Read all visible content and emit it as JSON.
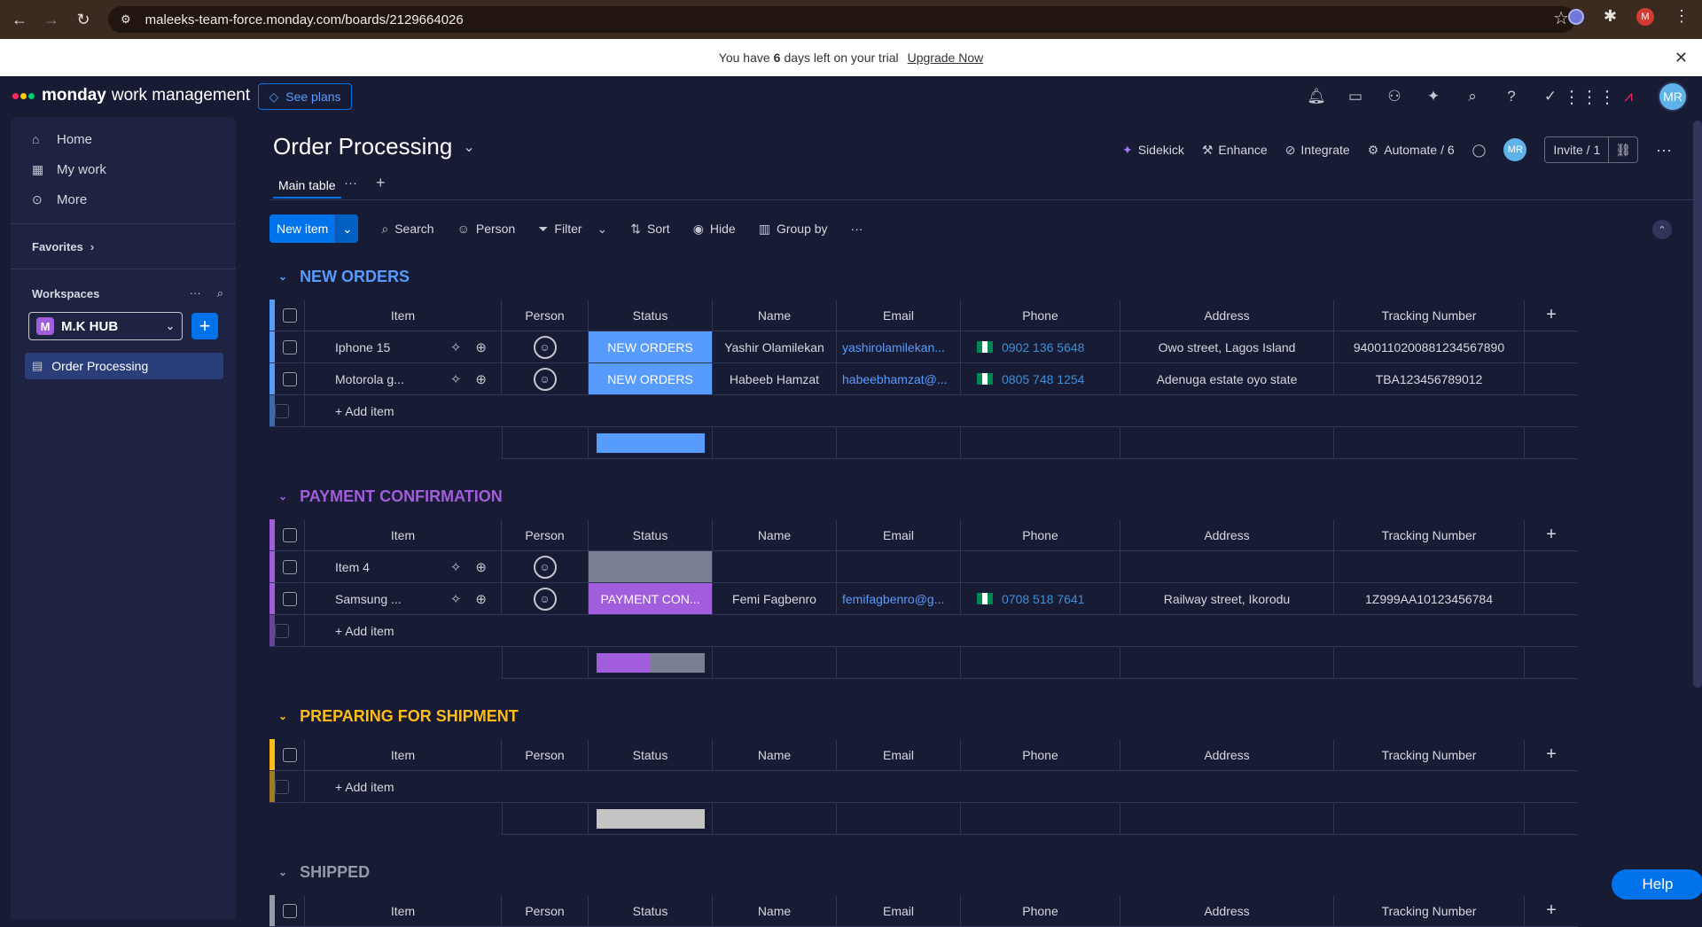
{
  "browser": {
    "url": "maleeks-team-force.monday.com/boards/2129664026",
    "avatar": "M"
  },
  "trial": {
    "text_before": "You have",
    "days": "6",
    "text_after": "days left on your trial",
    "upgrade_label": "Upgrade Now"
  },
  "topbar": {
    "brand": "monday",
    "brand_suffix": "work management",
    "see_plans": "See plans",
    "avatar": "MR"
  },
  "sidebar": {
    "items": [
      {
        "label": "Home",
        "icon": "home-icon"
      },
      {
        "label": "My work",
        "icon": "calendar-icon"
      },
      {
        "label": "More",
        "icon": "more-icon"
      }
    ],
    "favorites": "Favorites",
    "workspaces": "Workspaces",
    "workspace_initial": "M",
    "workspace_name": "M.K HUB",
    "board": "Order Processing"
  },
  "board": {
    "title": "Order Processing",
    "tab": "Main table",
    "actions": {
      "sidekick": "Sidekick",
      "enhance": "Enhance",
      "integrate": "Integrate",
      "automate": "Automate / 6",
      "avatar": "MR",
      "invite": "Invite / 1"
    },
    "toolbar": {
      "new_item": "New item",
      "search": "Search",
      "person": "Person",
      "filter": "Filter",
      "sort": "Sort",
      "hide": "Hide",
      "group_by": "Group by"
    }
  },
  "columns": [
    "Item",
    "Person",
    "Status",
    "Name",
    "Email",
    "Phone",
    "Address",
    "Tracking Number"
  ],
  "add_item": "+ Add item",
  "groups": [
    {
      "title": "NEW ORDERS",
      "color": "#579bfc",
      "rows": [
        {
          "item": "Iphone 15",
          "status": "NEW ORDERS",
          "status_color": "#579bfc",
          "name": "Yashir Olamilekan",
          "email": "yashirolamilekan...",
          "phone": "0902 136 5648",
          "address": "Owo street, Lagos Island",
          "tracking": "9400110200881234567890"
        },
        {
          "item": "Motorola g...",
          "status": "NEW ORDERS",
          "status_color": "#579bfc",
          "name": "Habeeb Hamzat",
          "email": "habeebhamzat@...",
          "phone": "0805 748 1254",
          "address": "Adenuga estate oyo state",
          "tracking": "TBA123456789012"
        }
      ],
      "summary": [
        {
          "color": "#579bfc",
          "fraction": 1.0
        }
      ]
    },
    {
      "title": "PAYMENT CONFIRMATION",
      "color": "#a25ddc",
      "rows": [
        {
          "item": "Item 4",
          "status": "",
          "status_color": "#797e93",
          "name": "",
          "email": "",
          "phone": "",
          "address": "",
          "tracking": ""
        },
        {
          "item": "Samsung ...",
          "status": "PAYMENT CON...",
          "status_color": "#a25ddc",
          "name": "Femi Fagbenro",
          "email": "femifagbenro@g...",
          "phone": "0708 518 7641",
          "address": "Railway street, Ikorodu",
          "tracking": "1Z999AA10123456784"
        }
      ],
      "summary": [
        {
          "color": "#a25ddc",
          "fraction": 0.5
        },
        {
          "color": "#797e93",
          "fraction": 0.5
        }
      ]
    },
    {
      "title": "PREPARING FOR SHIPMENT",
      "color": "#fdbc1a",
      "rows": [],
      "summary": [
        {
          "color": "#c4c4c4",
          "fraction": 1.0
        }
      ]
    },
    {
      "title": "SHIPPED",
      "color": "#9699a6",
      "rows": [],
      "summary": []
    }
  ],
  "help": "Help"
}
